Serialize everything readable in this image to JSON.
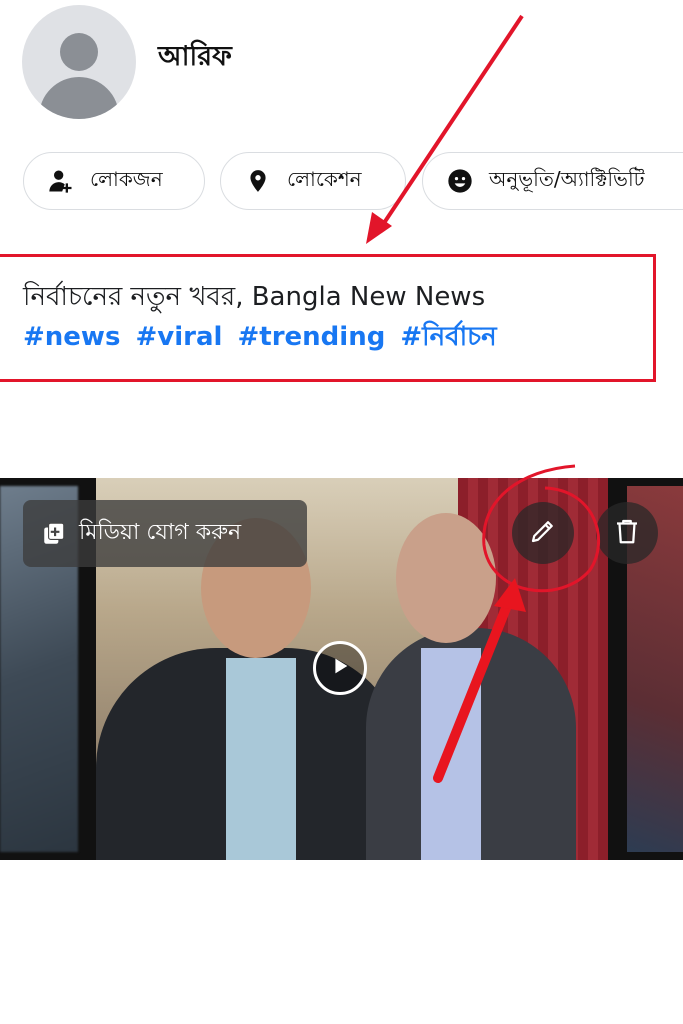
{
  "profile": {
    "name": "আরিফ"
  },
  "chips": [
    {
      "label": "লোকজন",
      "icon": "person-add-icon"
    },
    {
      "label": "লোকেশন",
      "icon": "location-pin-icon"
    },
    {
      "label": "অনুভূতি/অ্যাক্টিভিটি",
      "icon": "smiley-icon"
    }
  ],
  "post": {
    "caption": "নির্বাচনের নতুন খবর, Bangla New News",
    "hashtags": [
      "#news",
      "#viral",
      "#trending",
      "#নির্বাচন"
    ]
  },
  "media": {
    "add_media_label": "মিডিয়া যোগ করুন",
    "edit_icon": "pencil-icon",
    "delete_icon": "trash-icon",
    "play_icon": "play-icon"
  },
  "colors": {
    "annotation_red": "#e2152a",
    "hashtag_blue": "#1877f2",
    "chip_border": "#dadde1"
  }
}
